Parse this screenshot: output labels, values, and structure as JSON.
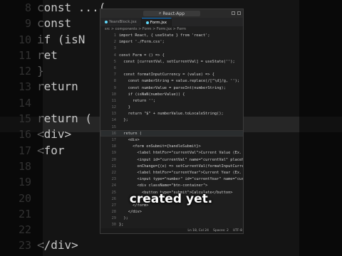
{
  "background": {
    "lines": [
      "8",
      "9",
      "10",
      "11",
      "12",
      "13",
      "14",
      "15",
      "16",
      "17",
      "18",
      "19",
      "20",
      "21",
      "22",
      "23"
    ],
    "code": [
      "const ...(...",
      "const     berString);",
      "if (isN",
      "ret",
      "}",
      "return        string();",
      "",
      "return (",
      "<div>",
      "<for",
      "",
      "",
      "",
      "",
      "",
      "</div>"
    ]
  },
  "window": {
    "title": "React-App",
    "tabs": [
      {
        "label": "YearsBlock.jsx",
        "active": false
      },
      {
        "label": "Form.jsx",
        "active": true
      }
    ],
    "breadcrumb": "src > components > Form > Form.jsx > Form",
    "gutter": [
      "1",
      "2",
      "3",
      "4",
      "5",
      "6",
      "7",
      "8",
      "9",
      "10",
      "11",
      "12",
      "13",
      "14",
      "15",
      "16",
      "17",
      "18",
      "19",
      "20",
      "21",
      "22",
      "23",
      "24",
      "25",
      "26",
      "27",
      "28",
      "29",
      "30"
    ],
    "code": [
      "import React, { useState } from 'react';",
      "import './Form.css';",
      "",
      "const Form = () => {",
      "  const [currentVal, setCurrentVal] = useState('');",
      "",
      "  const formatInputCurrency = (value) => {",
      "    const numberString = value.replace(/[^\\d]/g, '');",
      "    const numberValue = parseInt(numberString);",
      "    if (isNaN(numberValue)) {",
      "      return '';",
      "    }",
      "    return \"$\" + numberValue.toLocaleString();",
      "  };",
      "",
      "  return (",
      "    <div>",
      "      <form onSubmit={handleSubmit}>",
      "        <label htmlFor=\"currentVal\">Current Value (Ex. 100",
      "        <input id=\"currentVal\" name=\"currentVal\" placehold",
      "        onChange={(e) => setCurrentVal(formatInputCurrency",
      "        <label htmlFor=\"currentYear\">Current Year (Ex. 202",
      "        <input type=\"number\" id=\"currentYear\" name=\"curre",
      "        <div className=\"btn-container\">",
      "          <button type=\"submit\">Calculate</button>",
      "        </div>",
      "      </form>",
      "    </div>",
      "  );",
      "};"
    ],
    "status": {
      "position": "Ln 18, Col 24",
      "spaces": "Spaces: 2",
      "encoding": "UTF-8"
    }
  },
  "caption": "created yet."
}
